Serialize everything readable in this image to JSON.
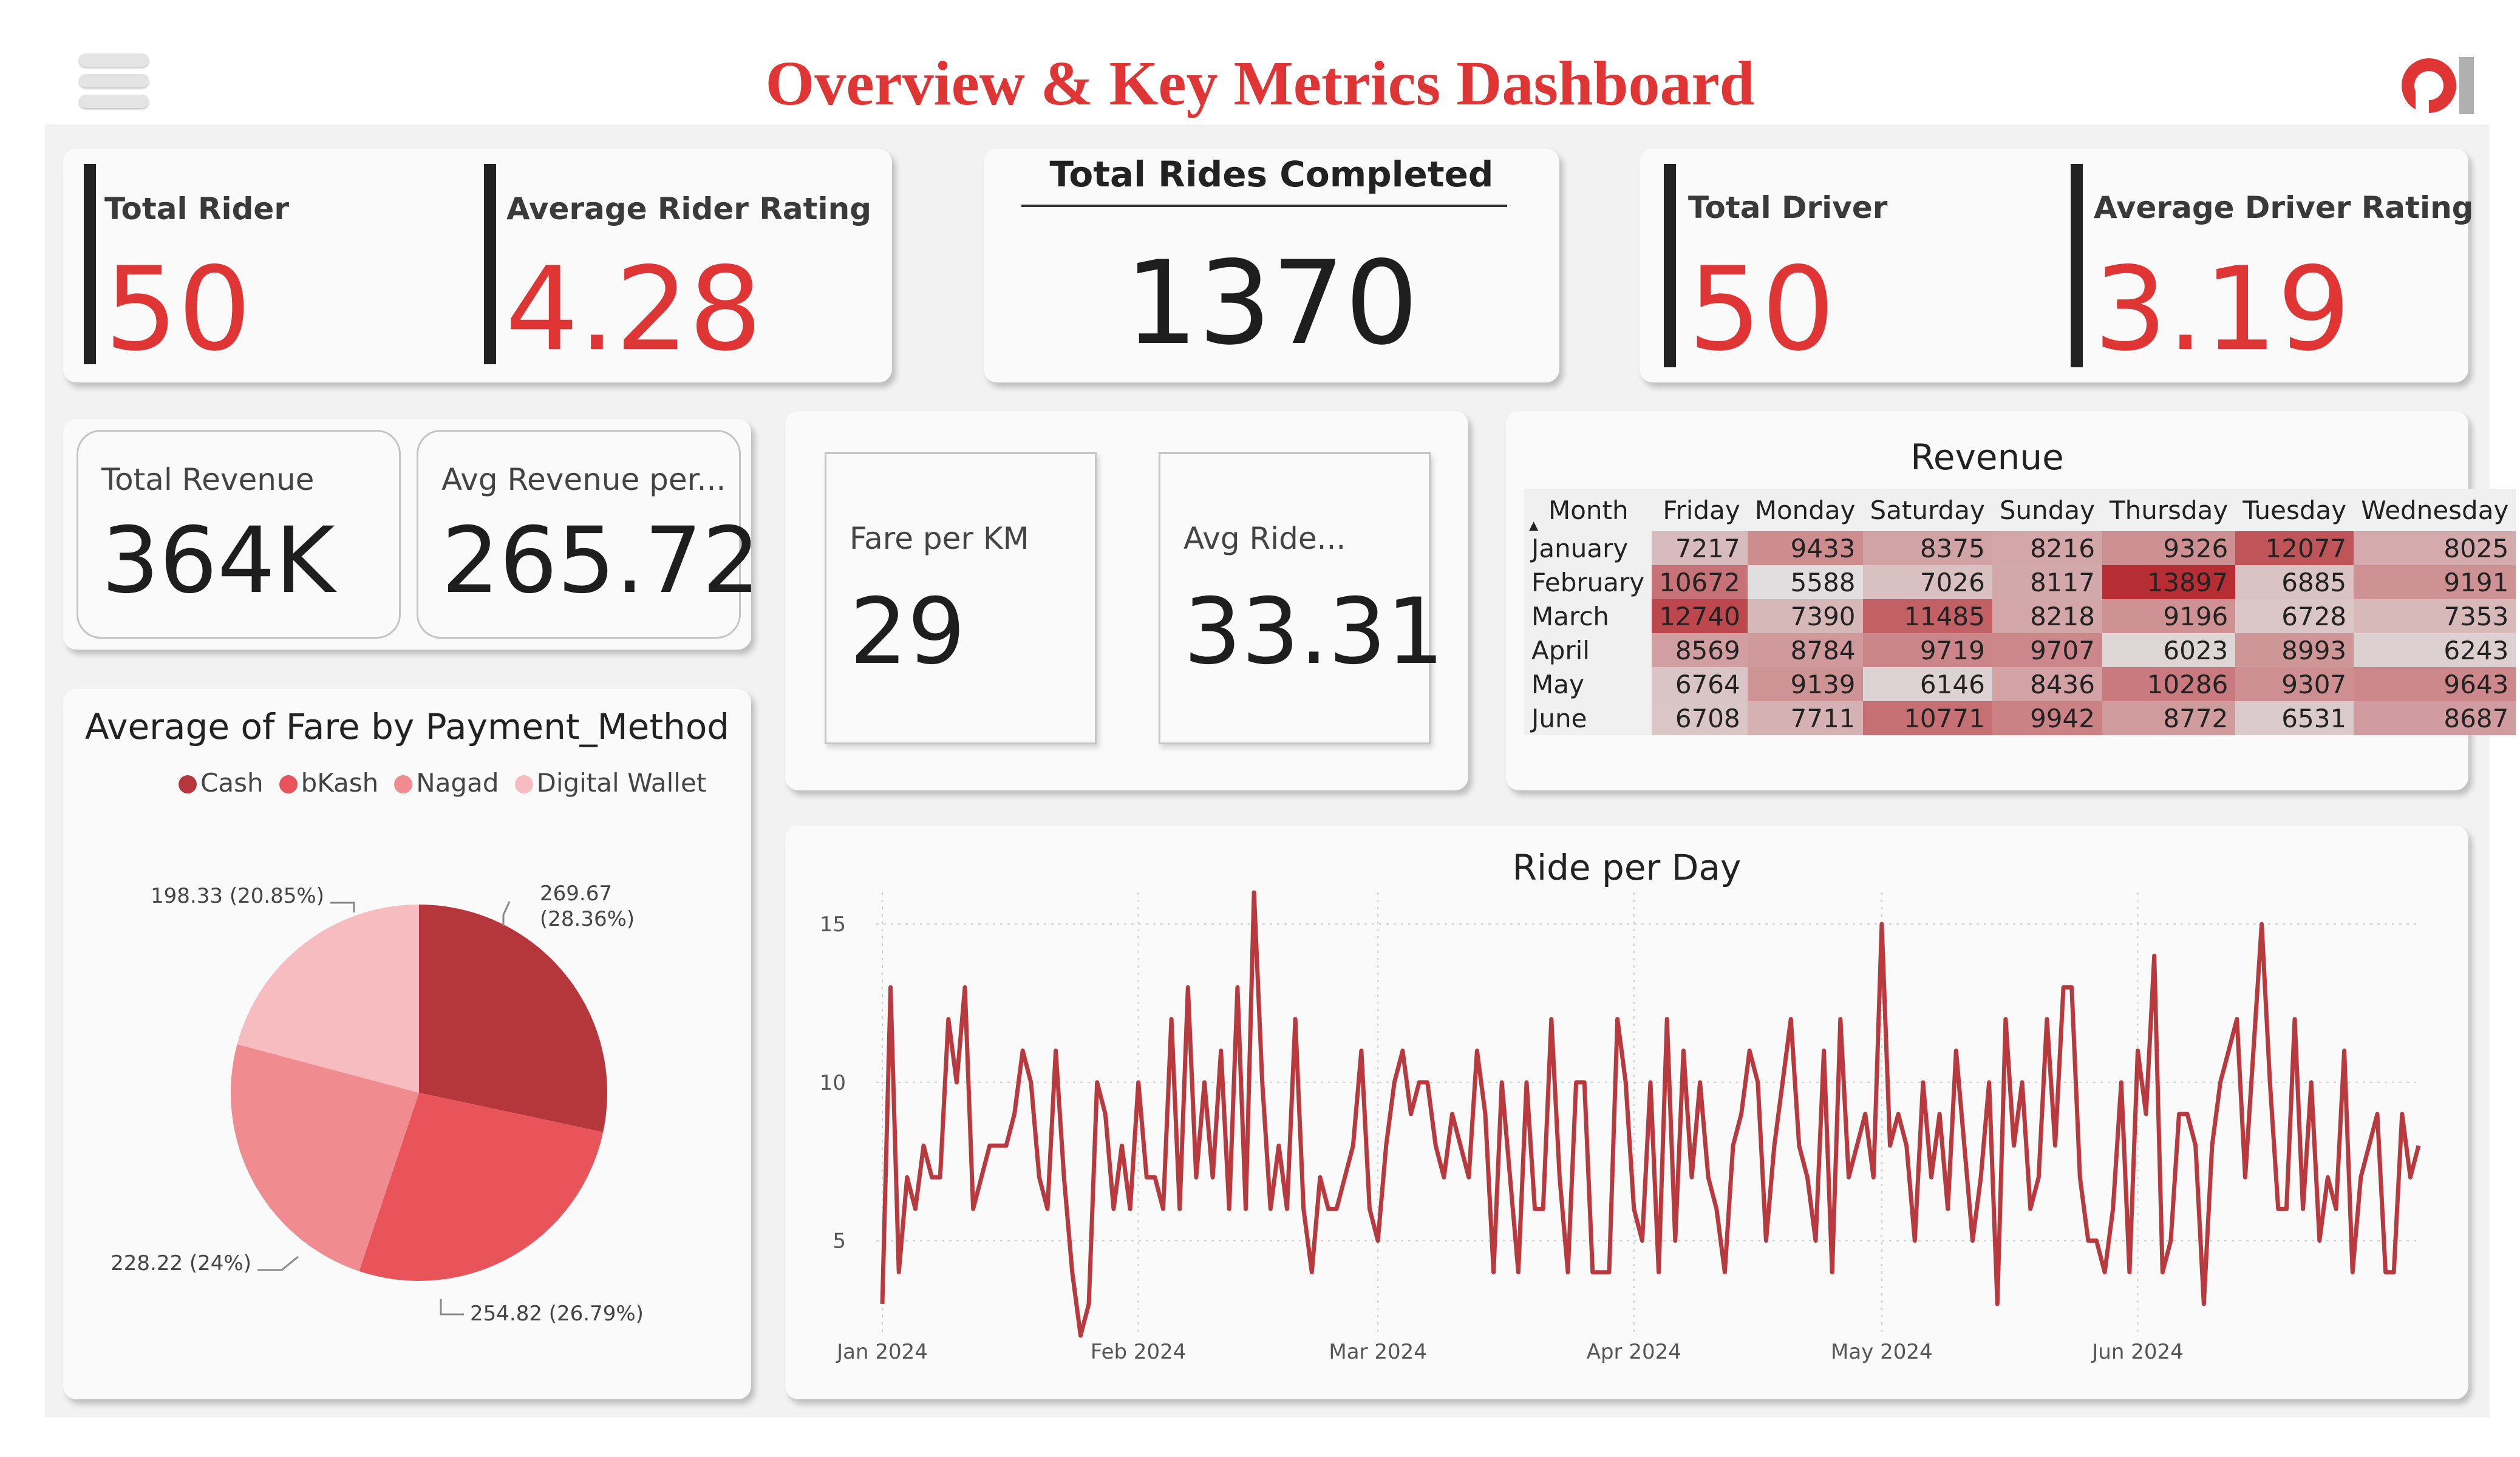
{
  "header": {
    "title": "Overview & Key Metrics Dashboard"
  },
  "kpis_left": {
    "total_rider_label": "Total Rider",
    "total_rider_value": "50",
    "avg_rider_rating_label": "Average Rider Rating",
    "avg_rider_rating_value": "4.28"
  },
  "kpi_center": {
    "label": "Total Rides Completed",
    "value": "1370"
  },
  "kpis_right": {
    "total_driver_label": "Total Driver",
    "total_driver_value": "50",
    "avg_driver_rating_label": "Average Driver Rating",
    "avg_driver_rating_value": "3.19"
  },
  "revenue_cards": {
    "total_revenue_label": "Total Revenue",
    "total_revenue_value": "364K",
    "avg_revenue_label": "Avg Revenue per...",
    "avg_revenue_value": "265.72"
  },
  "fare_cards": {
    "fare_per_km_label": "Fare per KM",
    "fare_per_km_value": "29",
    "avg_ride_label": "Avg Ride...",
    "avg_ride_value": "33.31"
  },
  "colors": {
    "accent": "#e03535",
    "cash": "#b5373c",
    "bkash": "#e8545a",
    "nagad": "#f08c90",
    "digital_wallet": "#f6bcc0",
    "line": "#b83a3f"
  },
  "chart_data": [
    {
      "type": "pie",
      "title": "Average of Fare by Payment_Method",
      "legend_position": "top",
      "slices": [
        {
          "name": "Cash",
          "value": 269.67,
          "label": "269.67",
          "label2": "(28.36%)"
        },
        {
          "name": "bKash",
          "value": 254.82,
          "label": "254.82 (26.79%)"
        },
        {
          "name": "Nagad",
          "value": 228.22,
          "label": "228.22 (24%)"
        },
        {
          "name": "Digital Wallet",
          "value": 198.33,
          "label": "198.33 (20.85%)"
        }
      ]
    },
    {
      "type": "table",
      "title": "Revenue",
      "columns": [
        "Month",
        "Friday",
        "Monday",
        "Saturday",
        "Sunday",
        "Thursday",
        "Tuesday",
        "Wednesday"
      ],
      "rows": [
        [
          "January",
          7217,
          9433,
          8375,
          8216,
          9326,
          12077,
          8025
        ],
        [
          "February",
          10672,
          5588,
          7026,
          8117,
          13897,
          6885,
          9191
        ],
        [
          "March",
          12740,
          7390,
          11485,
          8218,
          9196,
          6728,
          7353
        ],
        [
          "April",
          8569,
          8784,
          9719,
          9707,
          6023,
          8993,
          6243
        ],
        [
          "May",
          6764,
          9139,
          6146,
          8436,
          10286,
          9307,
          9643
        ],
        [
          "June",
          6708,
          7711,
          10771,
          9942,
          8772,
          6531,
          8687
        ]
      ]
    },
    {
      "type": "line",
      "title": "Ride per Day",
      "x_start": "2024-01-01",
      "x_ticks": [
        "Jan 2024",
        "Feb 2024",
        "Mar 2024",
        "Apr 2024",
        "May 2024",
        "Jun 2024"
      ],
      "y_ticks": [
        5,
        10,
        15
      ],
      "ylim": [
        2,
        16
      ],
      "grid": true,
      "values": [
        3,
        13,
        4,
        7,
        6,
        8,
        7,
        7,
        12,
        10,
        13,
        6,
        7,
        8,
        8,
        8,
        9,
        11,
        10,
        7,
        6,
        11,
        7,
        4,
        2,
        3,
        10,
        9,
        6,
        8,
        6,
        10,
        7,
        7,
        6,
        12,
        6,
        13,
        7,
        10,
        7,
        11,
        6,
        13,
        6,
        16,
        10,
        6,
        8,
        6,
        12,
        6,
        4,
        7,
        6,
        6,
        7,
        8,
        11,
        6,
        5,
        8,
        10,
        11,
        9,
        10,
        10,
        8,
        7,
        9,
        8,
        7,
        11,
        9,
        4,
        10,
        7,
        4,
        10,
        6,
        6,
        12,
        7,
        4,
        10,
        10,
        4,
        4,
        4,
        12,
        10,
        6,
        5,
        10,
        4,
        12,
        5,
        11,
        7,
        10,
        7,
        6,
        4,
        8,
        9,
        11,
        10,
        5,
        8,
        10,
        12,
        8,
        7,
        5,
        11,
        4,
        12,
        7,
        8,
        9,
        7,
        15,
        8,
        9,
        8,
        5,
        10,
        7,
        9,
        6,
        11,
        8,
        5,
        7,
        10,
        3,
        12,
        8,
        10,
        6,
        7,
        12,
        8,
        13,
        13,
        7,
        5,
        5,
        4,
        6,
        10,
        4,
        11,
        9,
        14,
        4,
        5,
        9,
        9,
        8,
        3,
        8,
        10,
        11,
        12,
        7,
        11,
        15,
        10,
        6,
        6,
        12,
        6,
        10,
        5,
        7,
        6,
        11,
        4,
        7,
        8,
        9,
        4,
        4,
        9,
        7,
        8
      ]
    }
  ]
}
